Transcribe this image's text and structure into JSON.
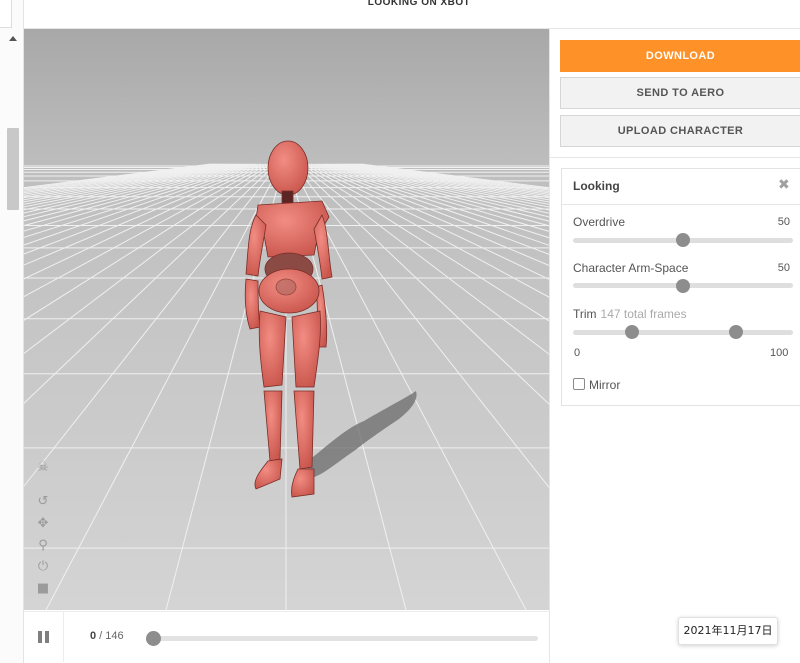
{
  "header": {
    "title": "LOOKING ON XBOT"
  },
  "toolbar": {
    "icons": [
      "skull-icon",
      "undo-icon",
      "move-icon",
      "zoom-icon",
      "power-icon",
      "camera-icon"
    ]
  },
  "playback": {
    "current_frame": "0",
    "separator": " / ",
    "total_frames": "146",
    "progress": 0
  },
  "actions": {
    "download": "DOWNLOAD",
    "send_to_aero": "SEND TO AERO",
    "upload_character": "UPLOAD CHARACTER"
  },
  "settings": {
    "title": "Looking",
    "close_glyph": "✖",
    "overdrive": {
      "label": "Overdrive",
      "value": "50",
      "fraction": 0.5
    },
    "arm_space": {
      "label": "Character Arm-Space",
      "value": "50",
      "fraction": 0.5
    },
    "trim": {
      "label": "Trim",
      "sublabel": "147 total frames",
      "min_label": "0",
      "max_label": "100",
      "start_fraction": 0.27,
      "end_fraction": 0.74
    },
    "mirror": {
      "label": "Mirror",
      "checked": false
    }
  },
  "datebox": {
    "text": "2021年11月17日"
  },
  "colors": {
    "accent": "#ff9129",
    "figure": "#e0695f",
    "floor": "#c7c7c7"
  }
}
